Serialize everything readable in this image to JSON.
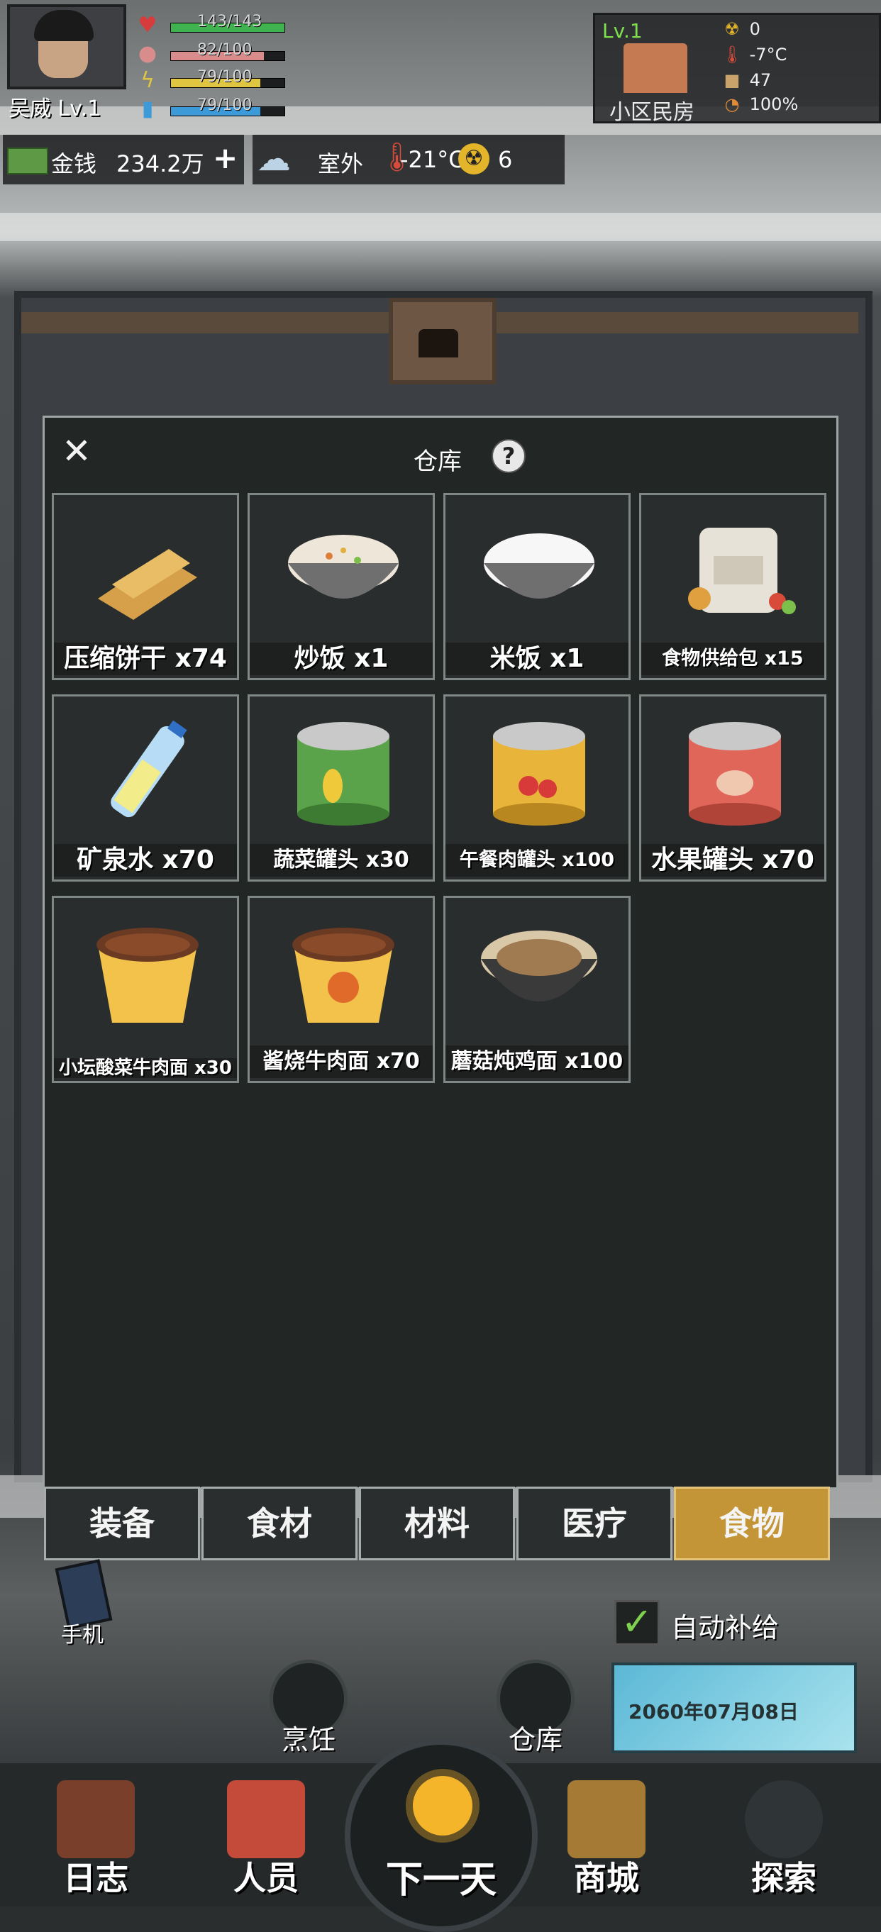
{
  "player": {
    "name": "吴威 Lv.1",
    "stats": [
      {
        "icon": "heart-icon",
        "text": "143/143",
        "fill": 1.0,
        "color": "#3fb34f"
      },
      {
        "icon": "stomach-icon",
        "text": "82/100",
        "fill": 0.82,
        "color": "#d98c8c"
      },
      {
        "icon": "lightning-icon",
        "text": "79/100",
        "fill": 0.79,
        "color": "#e0c640"
      },
      {
        "icon": "water-icon",
        "text": "79/100",
        "fill": 0.79,
        "color": "#3d9ad8"
      }
    ]
  },
  "location": {
    "level": "Lv.1",
    "name": "小区民房",
    "radiation": "0",
    "temperature": "-7°C",
    "supplies": "47",
    "percent": "100%"
  },
  "money": {
    "label": "金钱",
    "value": "234.2万",
    "add": "+"
  },
  "weather": {
    "label": "室外",
    "temperature": "-21°C",
    "radiation": "6"
  },
  "dialog": {
    "title": "仓库",
    "help": "?",
    "close": "✕",
    "items": [
      {
        "label": "压缩饼干 x74",
        "icon": "biscuit-icon"
      },
      {
        "label": "炒饭 x1",
        "icon": "fried-rice-icon"
      },
      {
        "label": "米饭 x1",
        "icon": "rice-icon"
      },
      {
        "label": "食物供给包 x15",
        "icon": "food-pack-icon"
      },
      {
        "label": "矿泉水 x70",
        "icon": "water-bottle-icon"
      },
      {
        "label": "蔬菜罐头 x30",
        "icon": "vegetable-can-icon"
      },
      {
        "label": "午餐肉罐头 x100",
        "icon": "luncheon-can-icon"
      },
      {
        "label": "水果罐头 x70",
        "icon": "fruit-can-icon"
      },
      {
        "label": "小坛酸菜牛肉面 x30",
        "icon": "pickled-noodle-icon"
      },
      {
        "label": "酱烧牛肉面 x70",
        "icon": "beef-noodle-icon"
      },
      {
        "label": "蘑菇炖鸡面 x100",
        "icon": "mushroom-noodle-icon"
      }
    ],
    "tabs": [
      "装备",
      "食材",
      "材料",
      "医疗",
      "食物"
    ],
    "active_tab": "食物"
  },
  "bottom": {
    "phone": "手机",
    "auto_supply": "自动补给",
    "auto_checked": true,
    "date": "2060年07月08日",
    "cook": "烹饪",
    "warehouse": "仓库",
    "nav": [
      "日志",
      "人员",
      "下一天",
      "商城",
      "探索"
    ]
  },
  "colors": {
    "accent": "#c49536",
    "panel": "#222625",
    "border": "#9ea3a3"
  }
}
